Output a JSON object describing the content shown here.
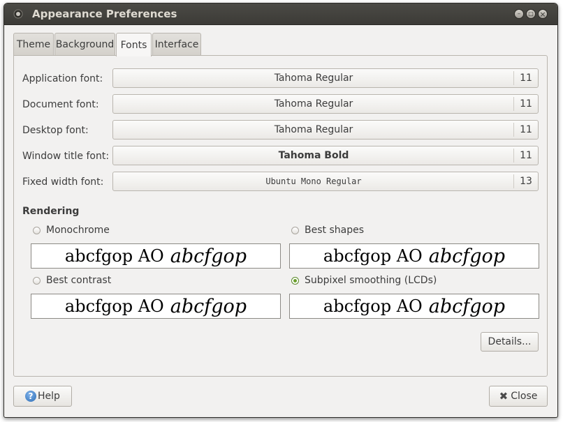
{
  "window": {
    "title": "Appearance Preferences",
    "controls": {
      "minimize": "–",
      "maximize": "□",
      "close": "×"
    }
  },
  "tabs": [
    {
      "label": "Theme"
    },
    {
      "label": "Background"
    },
    {
      "label": "Fonts"
    },
    {
      "label": "Interface"
    }
  ],
  "fonts": {
    "application": {
      "label": "Application font:",
      "name": "Tahoma Regular",
      "size": "11"
    },
    "document": {
      "label": "Document font:",
      "name": "Tahoma Regular",
      "size": "11"
    },
    "desktop": {
      "label": "Desktop font:",
      "name": "Tahoma Regular",
      "size": "11"
    },
    "window_title": {
      "label": "Window title font:",
      "name": "Tahoma Bold",
      "size": "11"
    },
    "fixed_width": {
      "label": "Fixed width font:",
      "name": "Ubuntu Mono Regular",
      "size": "13"
    }
  },
  "rendering": {
    "title": "Rendering",
    "sample_text": "abcfgop AO",
    "sample_italic": "abcfgop",
    "options": {
      "monochrome": "Monochrome",
      "best_shapes": "Best shapes",
      "best_contrast": "Best contrast",
      "subpixel": "Subpixel smoothing (LCDs)"
    },
    "selected": "Subpixel smoothing (LCDs)"
  },
  "buttons": {
    "details": "Details...",
    "help": "Help",
    "close": "Close"
  },
  "colors": {
    "accent_radio": "#6a9f2c",
    "titlebar": "#3c3b37",
    "window_bg": "#f2f1f0"
  }
}
